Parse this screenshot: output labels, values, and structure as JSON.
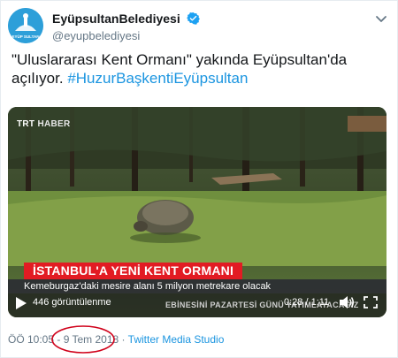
{
  "account": {
    "display_name": "EyüpsultanBelediyesi",
    "handle": "@eyupbelediyesi",
    "avatar_text": "EYÜP SULTAN"
  },
  "tweet": {
    "text": "\"Uluslararası Kent Ormanı\" yakında Eyüpsultan'da açılıyor. ",
    "hashtag": "#HuzurBaşkentiEyüpsultan"
  },
  "video": {
    "channel": "TRT",
    "channel_suffix": "HABER",
    "headline": "İSTANBUL'A YENİ KENT ORMANI",
    "subtitle": "Kemeburgaz'daki mesire alanı 5 milyon metrekare olacak",
    "ticker": "EBİNESİNİ PAZARTESİ GÜNÜ YAYIMLAYACAĞIZ",
    "views": "446 görüntülenme",
    "timecode": "0:28 / 1:11"
  },
  "meta": {
    "time": "ÖÖ 10:05",
    "separator1": " - ",
    "date": "9 Tem 2018",
    "separator2": " · ",
    "source": "Twitter Media Studio"
  },
  "colors": {
    "brand_blue": "#1b95e0",
    "annotation_red": "#d0021b",
    "headline_red": "#e21b23"
  },
  "icons": [
    "verified-badge-icon",
    "chevron-down-icon",
    "play-icon",
    "volume-icon",
    "fullscreen-icon"
  ]
}
